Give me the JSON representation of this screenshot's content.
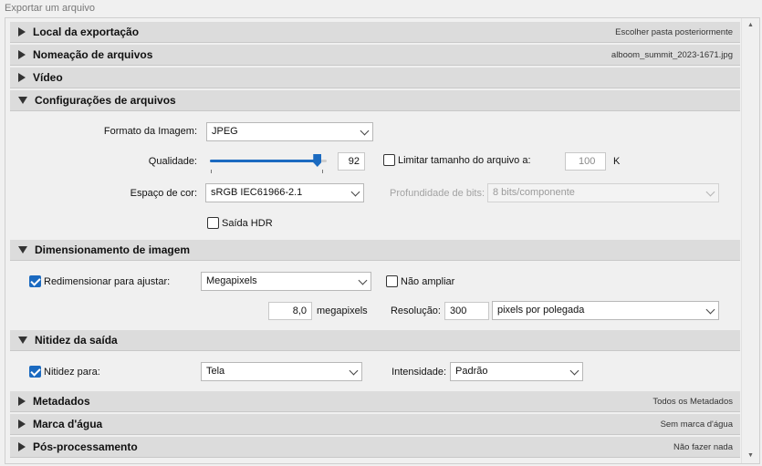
{
  "panel": {
    "title": "Exportar um arquivo"
  },
  "sections": {
    "local": {
      "title": "Local da exportação",
      "summary": "Escolher pasta posteriormente",
      "expanded": false
    },
    "naming": {
      "title": "Nomeação de arquivos",
      "summary": "alboom_summit_2023-1671.jpg",
      "expanded": false
    },
    "video": {
      "title": "Vídeo",
      "expanded": false
    },
    "file_settings": {
      "title": "Configurações de arquivos",
      "expanded": true,
      "format_label": "Formato da Imagem:",
      "format_value": "JPEG",
      "quality_label": "Qualidade:",
      "quality_value": "92",
      "quality_fraction": 0.92,
      "limit_size_label": "Limitar tamanho do arquivo a:",
      "limit_size_checked": false,
      "limit_size_value": "100",
      "limit_size_unit": "K",
      "color_space_label": "Espaço de cor:",
      "color_space_value": "sRGB IEC61966-2.1",
      "bit_depth_label": "Profundidade de bits:",
      "bit_depth_value": "8 bits/componente",
      "hdr_label": "Saída HDR",
      "hdr_checked": false
    },
    "sizing": {
      "title": "Dimensionamento de imagem",
      "expanded": true,
      "resize_label": "Redimensionar para ajustar:",
      "resize_checked": true,
      "resize_mode": "Megapixels",
      "no_enlarge_label": "Não ampliar",
      "no_enlarge_checked": false,
      "megapixels_value": "8,0",
      "megapixels_unit": "megapixels",
      "resolution_label": "Resolução:",
      "resolution_value": "300",
      "resolution_unit": "pixels por polegada"
    },
    "sharpening": {
      "title": "Nitidez da saída",
      "expanded": true,
      "sharpen_label": "Nitidez para:",
      "sharpen_checked": true,
      "sharpen_target": "Tela",
      "amount_label": "Intensidade:",
      "amount_value": "Padrão"
    },
    "metadata": {
      "title": "Metadados",
      "summary": "Todos os Metadados",
      "expanded": false
    },
    "watermark": {
      "title": "Marca d'água",
      "summary": "Sem marca d'água",
      "expanded": false
    },
    "post": {
      "title": "Pós-processamento",
      "summary": "Não fazer nada",
      "expanded": false
    }
  }
}
